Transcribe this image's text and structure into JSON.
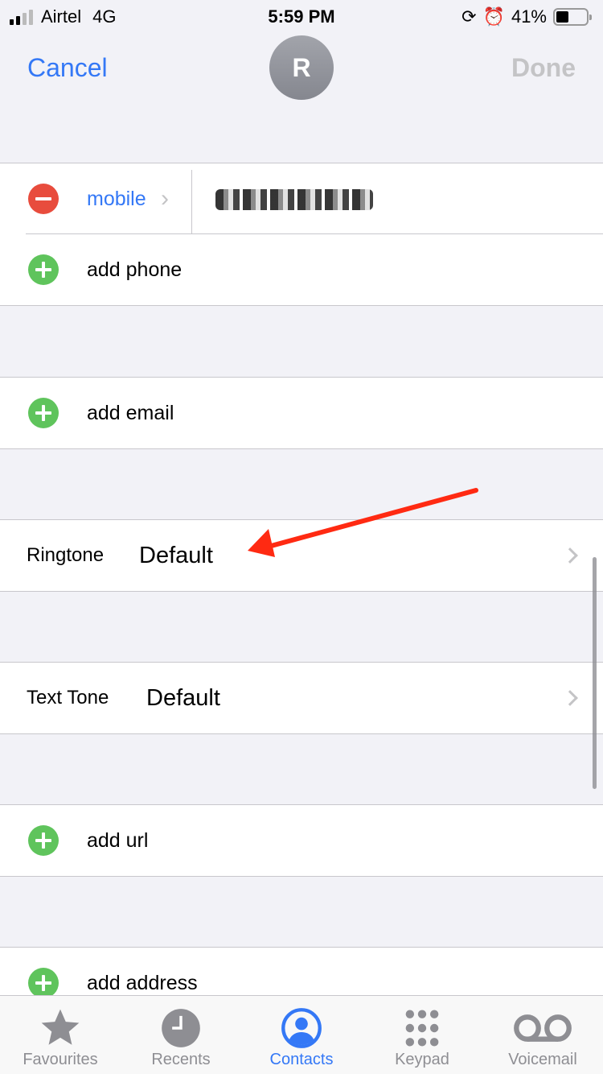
{
  "status_bar": {
    "carrier": "Airtel",
    "network": "4G",
    "time": "5:59 PM",
    "battery": "41%",
    "battery_level": 0.41,
    "signal_bars": 2
  },
  "nav": {
    "cancel": "Cancel",
    "done": "Done",
    "avatar_initial": "R"
  },
  "phone": {
    "label": "mobile",
    "value_redacted": true,
    "add_label": "add phone"
  },
  "email": {
    "add_label": "add email"
  },
  "ringtone": {
    "label": "Ringtone",
    "value": "Default"
  },
  "text_tone": {
    "label": "Text Tone",
    "value": "Default"
  },
  "url": {
    "add_label": "add url"
  },
  "address": {
    "add_label": "add address"
  },
  "annotation": {
    "type": "red-arrow",
    "points_to": "ringtone-value",
    "color": "#ff2a12"
  },
  "tabs": [
    {
      "label": "Favourites",
      "icon": "star-icon",
      "active": false
    },
    {
      "label": "Recents",
      "icon": "clock-icon",
      "active": false
    },
    {
      "label": "Contacts",
      "icon": "person-circle-icon",
      "active": true
    },
    {
      "label": "Keypad",
      "icon": "keypad-icon",
      "active": false
    },
    {
      "label": "Voicemail",
      "icon": "voicemail-icon",
      "active": false
    }
  ],
  "colors": {
    "accent": "#3478f6",
    "destructive": "#e84c3d",
    "add": "#5fc45c",
    "inactive": "#8e8e93"
  }
}
